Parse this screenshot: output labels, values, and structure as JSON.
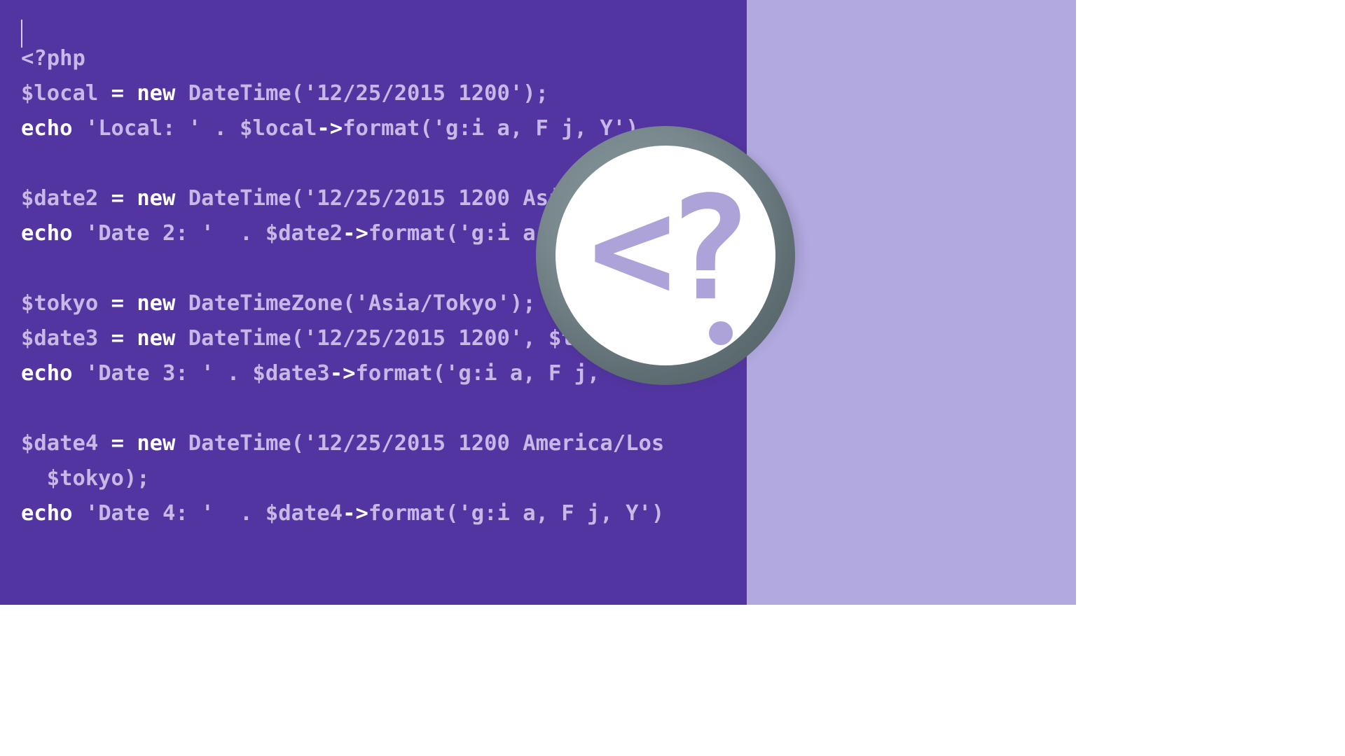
{
  "colors": {
    "bg_main": "#5235a0",
    "bg_stripe": "#b1a9df",
    "code_dim": "#c7b8e6",
    "code_bright": "#ffffff",
    "coin_ring_light": "#86989d",
    "coin_ring_dark": "#4c5b5f",
    "coin_face": "#ffffff",
    "glyph": "#aea3d8"
  },
  "coin": {
    "glyph": "<?"
  },
  "code": {
    "lines": [
      [
        {
          "t": "<?php",
          "c": "tag"
        }
      ],
      [
        {
          "t": "$local",
          "c": "var"
        },
        {
          "t": " ",
          "c": "pun"
        },
        {
          "t": "=",
          "c": "op"
        },
        {
          "t": " ",
          "c": "pun"
        },
        {
          "t": "new",
          "c": "kw"
        },
        {
          "t": " DateTime",
          "c": "cls"
        },
        {
          "t": "(",
          "c": "pun"
        },
        {
          "t": "'12/25/2015 1200'",
          "c": "str"
        },
        {
          "t": ");",
          "c": "pun"
        }
      ],
      [
        {
          "t": "echo",
          "c": "kw"
        },
        {
          "t": " ",
          "c": "pun"
        },
        {
          "t": "'Local: '",
          "c": "str"
        },
        {
          "t": " . $local",
          "c": "var"
        },
        {
          "t": "->",
          "c": "arr"
        },
        {
          "t": "format",
          "c": "fn"
        },
        {
          "t": "(",
          "c": "pun"
        },
        {
          "t": "'g:i a, F j, Y'",
          "c": "str"
        },
        {
          "t": ") .",
          "c": "pun"
        }
      ],
      [],
      [
        {
          "t": "$date2",
          "c": "var"
        },
        {
          "t": " ",
          "c": "pun"
        },
        {
          "t": "=",
          "c": "op"
        },
        {
          "t": " ",
          "c": "pun"
        },
        {
          "t": "new",
          "c": "kw"
        },
        {
          "t": " DateTime",
          "c": "cls"
        },
        {
          "t": "(",
          "c": "pun"
        },
        {
          "t": "'12/25/2015 1200 Asia",
          "c": "str"
        }
      ],
      [
        {
          "t": "echo",
          "c": "kw"
        },
        {
          "t": " ",
          "c": "pun"
        },
        {
          "t": "'Date 2: '",
          "c": "str"
        },
        {
          "t": "  . $date2",
          "c": "var"
        },
        {
          "t": "->",
          "c": "arr"
        },
        {
          "t": "format",
          "c": "fn"
        },
        {
          "t": "(",
          "c": "pun"
        },
        {
          "t": "'g:i a, F",
          "c": "str"
        }
      ],
      [],
      [
        {
          "t": "$tokyo",
          "c": "var"
        },
        {
          "t": " ",
          "c": "pun"
        },
        {
          "t": "=",
          "c": "op"
        },
        {
          "t": " ",
          "c": "pun"
        },
        {
          "t": "new",
          "c": "kw"
        },
        {
          "t": " DateTimeZone",
          "c": "cls"
        },
        {
          "t": "(",
          "c": "pun"
        },
        {
          "t": "'Asia/Tokyo'",
          "c": "str"
        },
        {
          "t": ");",
          "c": "pun"
        }
      ],
      [
        {
          "t": "$date3",
          "c": "var"
        },
        {
          "t": " ",
          "c": "pun"
        },
        {
          "t": "=",
          "c": "op"
        },
        {
          "t": " ",
          "c": "pun"
        },
        {
          "t": "new",
          "c": "kw"
        },
        {
          "t": " DateTime",
          "c": "cls"
        },
        {
          "t": "(",
          "c": "pun"
        },
        {
          "t": "'12/25/2015 1200'",
          "c": "str"
        },
        {
          "t": ", $t",
          "c": "var"
        }
      ],
      [
        {
          "t": "echo",
          "c": "kw"
        },
        {
          "t": " ",
          "c": "pun"
        },
        {
          "t": "'Date 3: '",
          "c": "str"
        },
        {
          "t": " . $date3",
          "c": "var"
        },
        {
          "t": "->",
          "c": "arr"
        },
        {
          "t": "format",
          "c": "fn"
        },
        {
          "t": "(",
          "c": "pun"
        },
        {
          "t": "'g:i a, F j,",
          "c": "str"
        }
      ],
      [],
      [
        {
          "t": "$date4",
          "c": "var"
        },
        {
          "t": " ",
          "c": "pun"
        },
        {
          "t": "=",
          "c": "op"
        },
        {
          "t": " ",
          "c": "pun"
        },
        {
          "t": "new",
          "c": "kw"
        },
        {
          "t": " DateTime",
          "c": "cls"
        },
        {
          "t": "(",
          "c": "pun"
        },
        {
          "t": "'12/25/2015 1200 America/Los",
          "c": "str"
        }
      ],
      [
        {
          "t": "  $tokyo",
          "c": "var"
        },
        {
          "t": ");",
          "c": "pun"
        }
      ],
      [
        {
          "t": "echo",
          "c": "kw"
        },
        {
          "t": " ",
          "c": "pun"
        },
        {
          "t": "'Date 4: '",
          "c": "str"
        },
        {
          "t": "  . $date4",
          "c": "var"
        },
        {
          "t": "->",
          "c": "arr"
        },
        {
          "t": "format",
          "c": "fn"
        },
        {
          "t": "(",
          "c": "pun"
        },
        {
          "t": "'g:i a, F j, Y'",
          "c": "str"
        },
        {
          "t": ")",
          "c": "pun"
        }
      ]
    ]
  }
}
